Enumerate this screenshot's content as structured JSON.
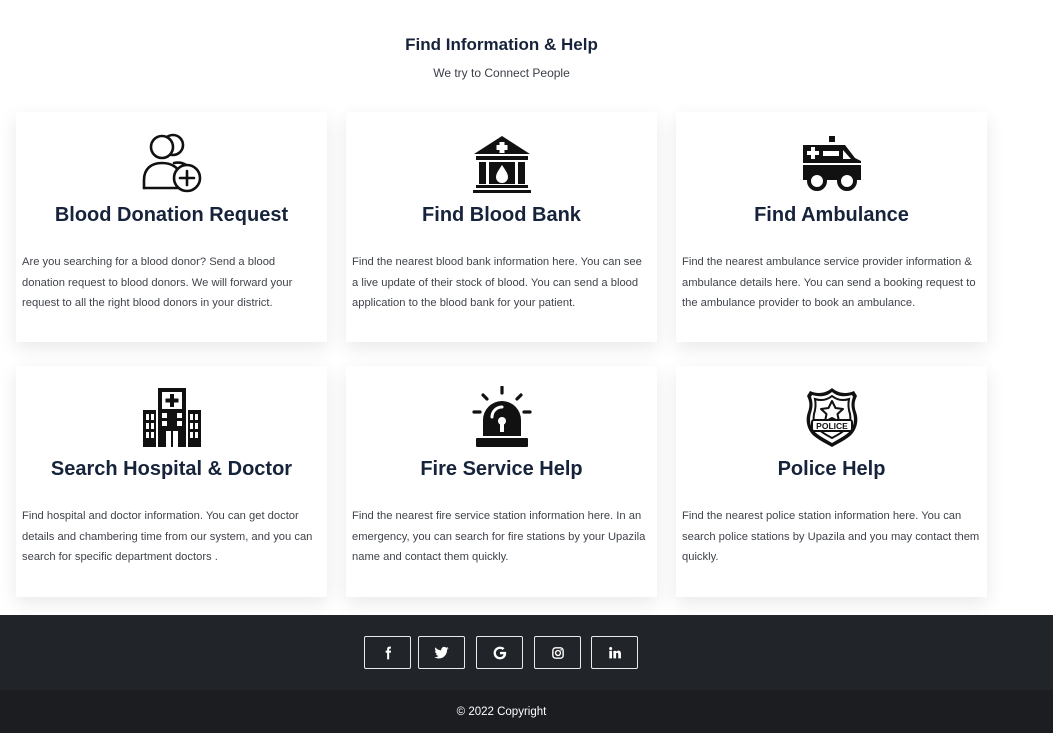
{
  "header": {
    "title": "Find Information & Help",
    "subtitle": "We try to Connect People"
  },
  "cards": [
    {
      "icon": "blood-donor-icon",
      "title": "Blood Donation Request",
      "description": "Are you searching for a blood donor? Send a blood donation request to blood donors. We will forward your request to all the right blood donors in your district."
    },
    {
      "icon": "blood-bank-icon",
      "title": "Find Blood Bank",
      "description": "Find the nearest blood bank information here. You can see a live update of their stock of blood. You can send a blood application to the blood bank for your patient."
    },
    {
      "icon": "ambulance-icon",
      "title": "Find Ambulance",
      "description": "Find the nearest ambulance service provider information & ambulance details here. You can send a booking request to the ambulance provider to book an ambulance."
    },
    {
      "icon": "hospital-icon",
      "title": "Search Hospital & Doctor",
      "description": "Find hospital and doctor information. You can get doctor details and chambering time from our system, and you can search for specific department doctors ."
    },
    {
      "icon": "siren-icon",
      "title": "Fire Service Help",
      "description": "Find the nearest fire service station information here. In an emergency, you can search for fire stations by your Upazila name and contact them quickly."
    },
    {
      "icon": "police-badge-icon",
      "title": "Police Help",
      "description": "Find the nearest police station information here. You can search police stations by Upazila and you may contact them quickly.",
      "badge_text": "POLICE"
    }
  ],
  "footer": {
    "social": [
      {
        "icon": "facebook-icon"
      },
      {
        "icon": "twitter-icon"
      },
      {
        "icon": "google-icon"
      },
      {
        "icon": "instagram-icon"
      },
      {
        "icon": "linkedin-icon"
      }
    ],
    "copyright": "© 2022 Copyright"
  }
}
